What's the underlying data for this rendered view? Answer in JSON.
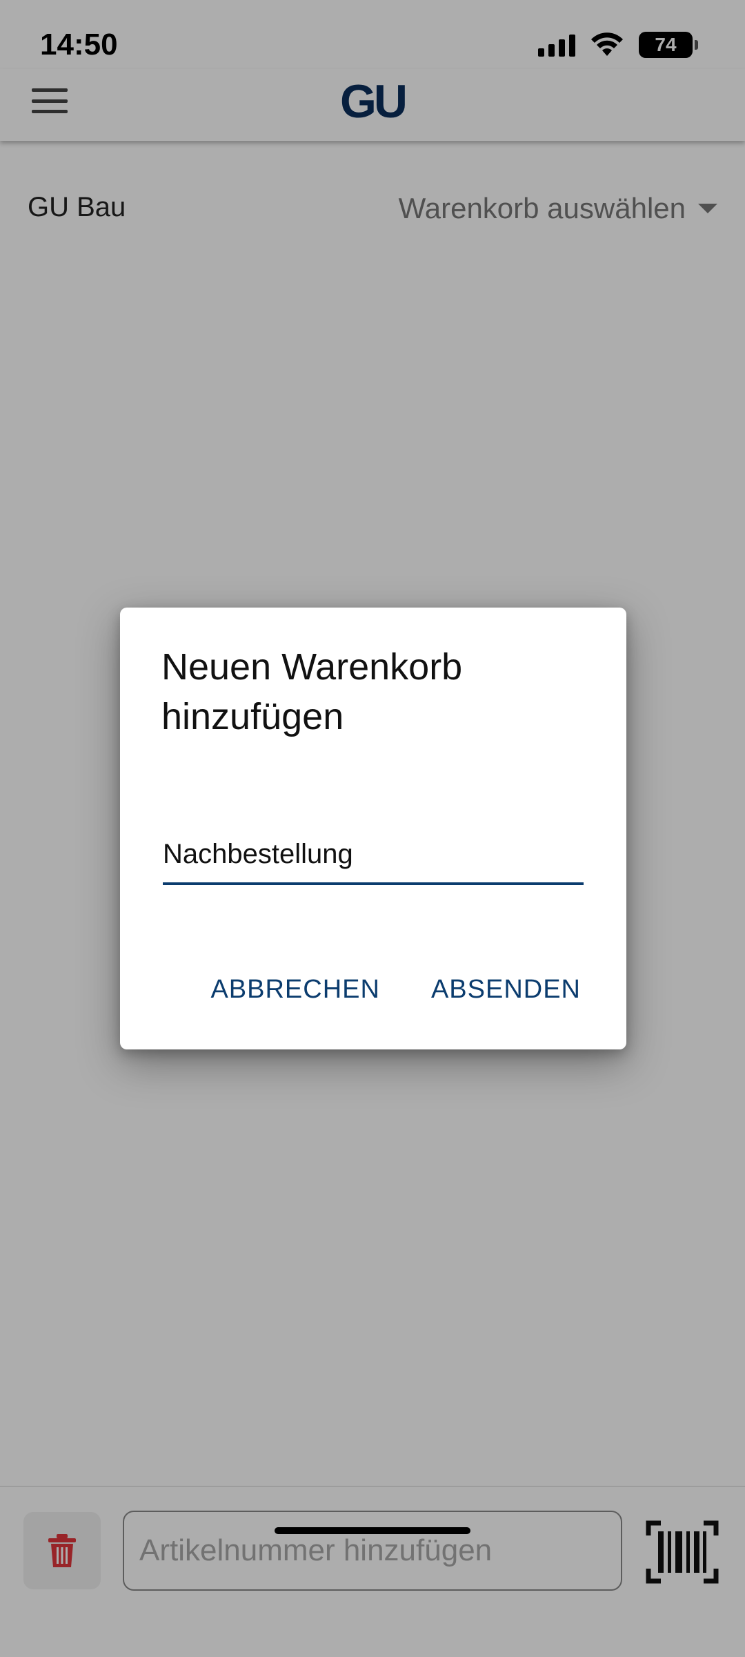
{
  "status_bar": {
    "time": "14:50",
    "battery": "74"
  },
  "header": {
    "logo": "GU"
  },
  "context": {
    "company": "GU Bau",
    "cart_select": "Warenkorb auswählen"
  },
  "bottom": {
    "article_placeholder": "Artikelnummer hinzufügen"
  },
  "dialog": {
    "title": "Neuen Warenkorb hinzufügen",
    "input_value": "Nachbestellung",
    "cancel_label": "ABBRECHEN",
    "submit_label": "ABSENDEN"
  },
  "colors": {
    "brand": "#0b3c6e",
    "logo": "#0b2f5c",
    "trash": "#e0363b"
  }
}
